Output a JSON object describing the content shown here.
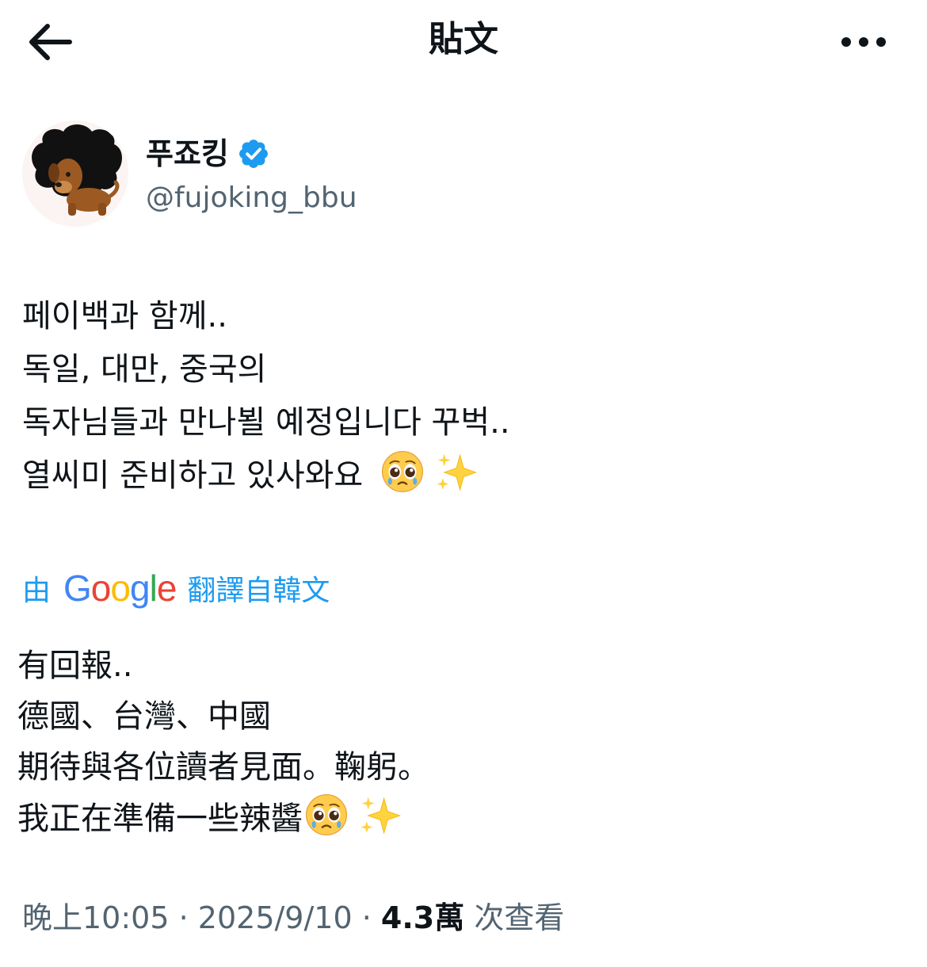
{
  "header": {
    "title": "貼文",
    "back_icon": "arrow-left-icon",
    "more_icon": "more-horizontal-icon"
  },
  "author": {
    "display_name": "푸죠킹",
    "handle": "@fujoking_bbu",
    "verified": true,
    "verified_color": "#1d9bf0",
    "avatar": "avatar-cartoon-dog-with-black-mane"
  },
  "tweet": {
    "lines": [
      "페이백과 함께..",
      "독일, 대만, 중국의",
      "독자님들과 만나뵐 예정입니다 꾸벅..",
      "열씨미 준비하고 있사와요"
    ],
    "emojis": [
      "pleading-face-emoji",
      "sparkles-emoji"
    ]
  },
  "translation": {
    "prefix": "由",
    "brand": "Google",
    "suffix": "翻譯自韓文",
    "link_color": "#1d9bf0",
    "lines": [
      "有回報..",
      "德國、台灣、中國",
      "期待與各位讀者見面。鞠躬。",
      "我正在準備一些辣醬"
    ]
  },
  "meta": {
    "time": "晚上10:05",
    "separator": "·",
    "date": "2025/9/10",
    "views_count": "4.3萬",
    "views_label": "次查看"
  }
}
